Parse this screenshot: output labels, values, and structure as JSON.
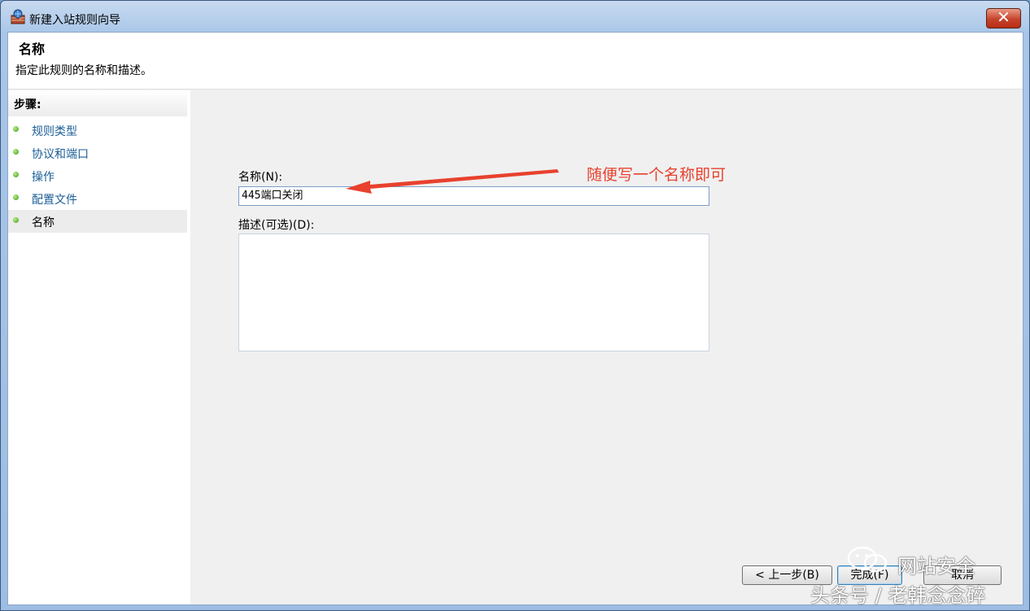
{
  "window": {
    "title": "新建入站规则向导",
    "close_glyph": "✕"
  },
  "header": {
    "title": "名称",
    "description": "指定此规则的名称和描述。"
  },
  "steps": {
    "header": "步骤:",
    "items": [
      {
        "label": "规则类型"
      },
      {
        "label": "协议和端口"
      },
      {
        "label": "操作"
      },
      {
        "label": "配置文件"
      },
      {
        "label": "名称"
      }
    ]
  },
  "form": {
    "name_label": "名称(N):",
    "name_value": "445端口关闭",
    "description_label": "描述(可选)(D):",
    "description_value": ""
  },
  "annotation": {
    "text": "随便写一个名称即可",
    "color": "#e8412e"
  },
  "buttons": {
    "back": "< 上一步(B)",
    "finish": "完成(F)",
    "cancel": "取消"
  },
  "watermark": {
    "line1": "网站安全",
    "line2": "头条号 / 老韩念念碎"
  },
  "colors": {
    "step_dot": "#3a9a16",
    "step_link": "#1b5e96",
    "close_button": "#c6432b"
  }
}
